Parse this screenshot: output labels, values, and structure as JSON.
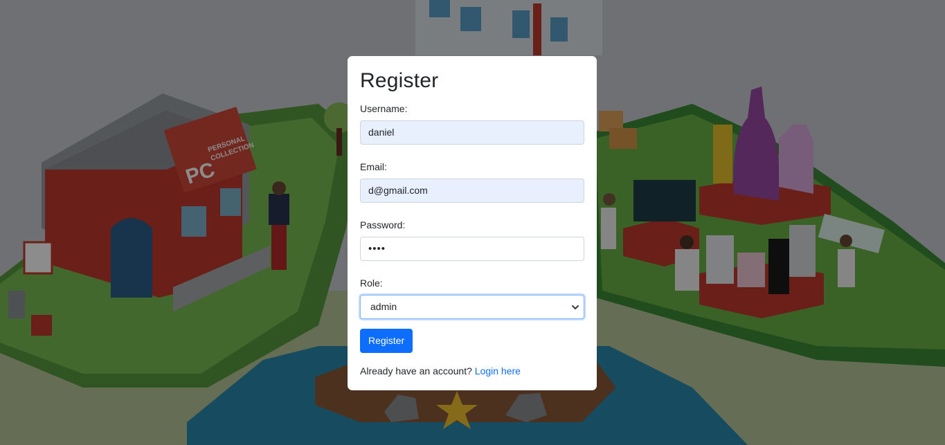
{
  "form": {
    "title": "Register",
    "username": {
      "label": "Username:",
      "value": "daniel"
    },
    "email": {
      "label": "Email:",
      "value": "d@gmail.com"
    },
    "password": {
      "label": "Password:",
      "value": "••••"
    },
    "role": {
      "label": "Role:",
      "selected": "admin"
    },
    "submit_label": "Register",
    "footer": {
      "prompt": "Already have an account?",
      "link": "Login here"
    }
  },
  "background": {
    "sign_text": "PC",
    "sign_subtext_1": "PERSONAL",
    "sign_subtext_2": "COLLECTION"
  },
  "colors": {
    "primary": "#0d6efd",
    "autofill": "#e8f0fe",
    "text": "#212529"
  }
}
